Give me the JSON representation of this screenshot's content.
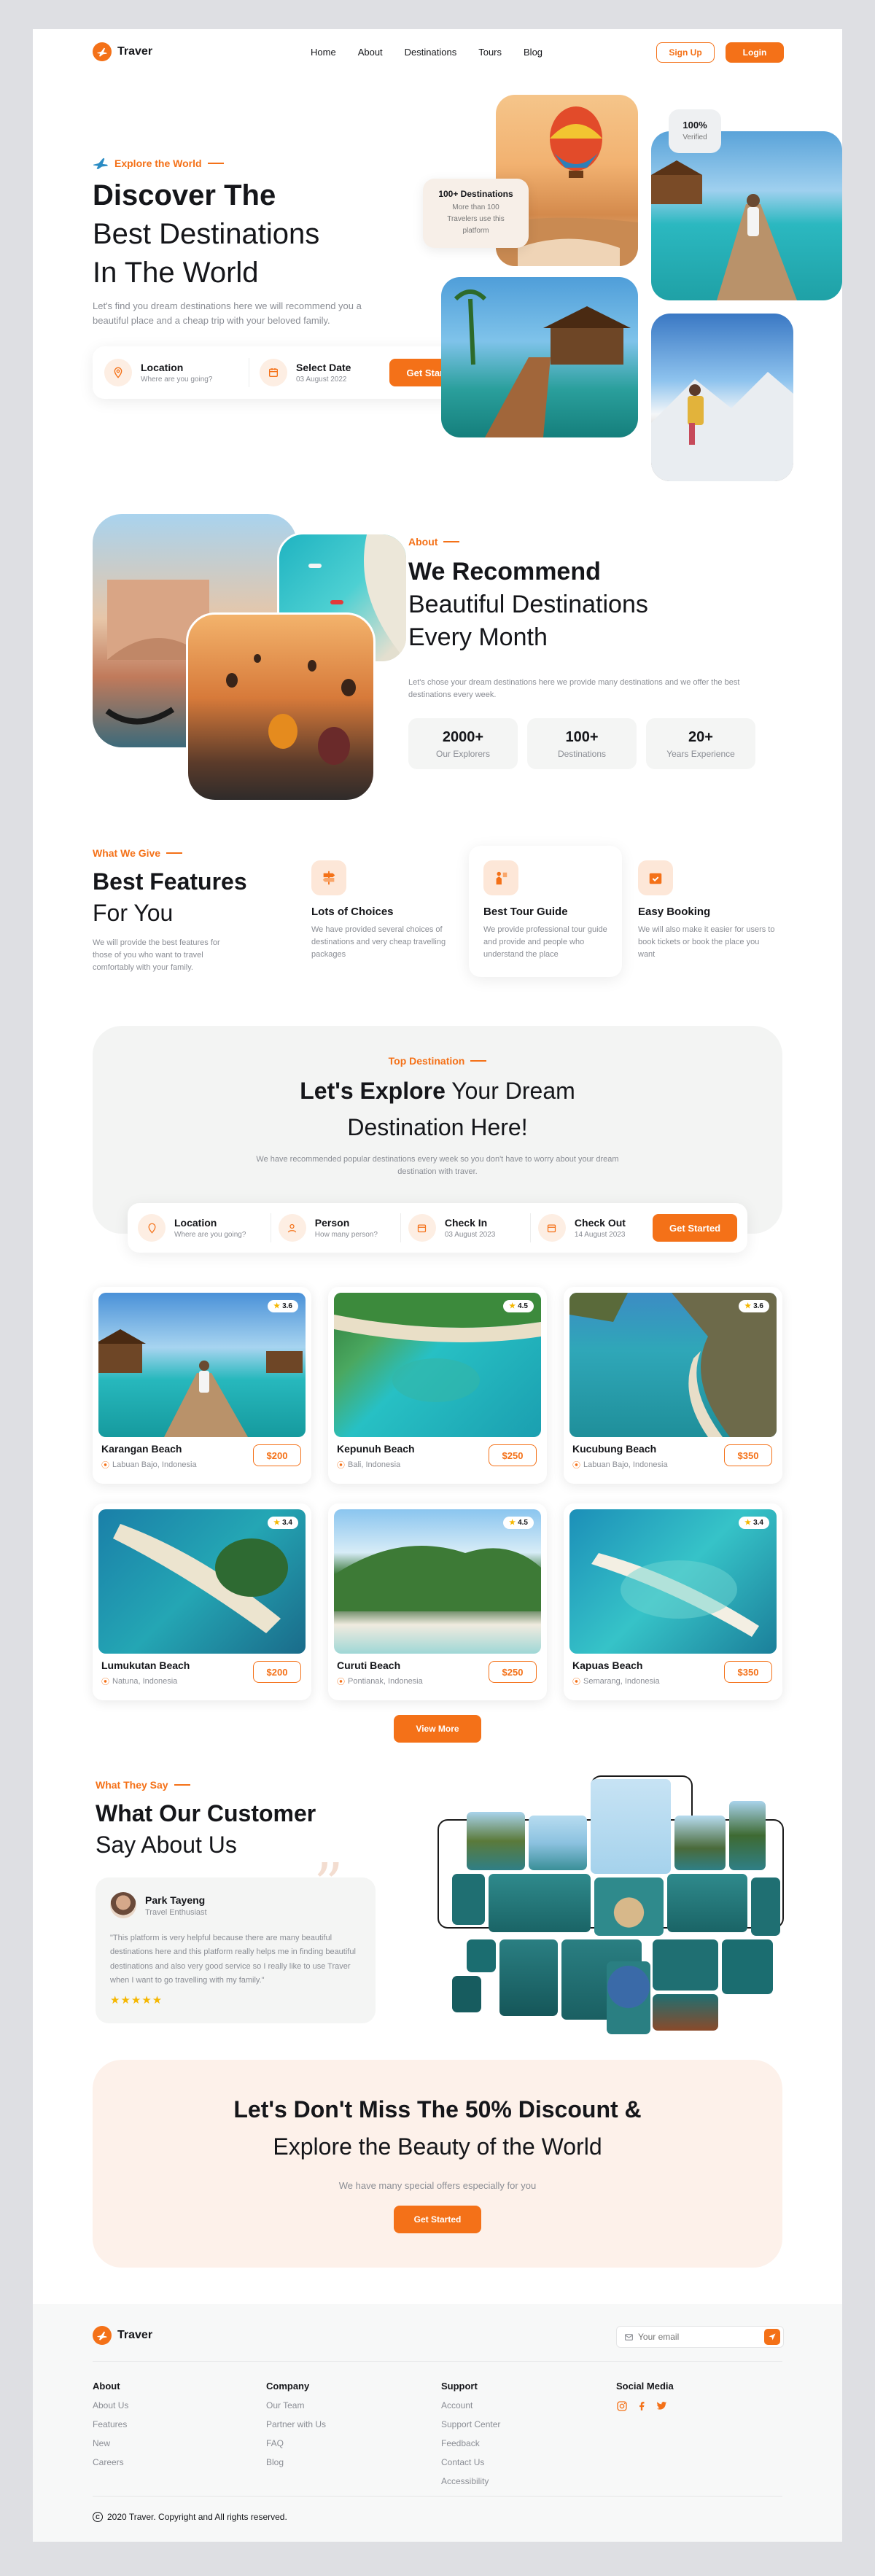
{
  "brand": {
    "name": "Traver",
    "accent": "#f47118"
  },
  "nav": {
    "items": [
      "Home",
      "About",
      "Destinations",
      "Tours",
      "Blog"
    ],
    "signup": "Sign Up",
    "login": "Login"
  },
  "hero": {
    "eyebrow": "Explore the World",
    "title_bold": "Discover The",
    "title_line2": "Best Destinations",
    "title_line3": "In The World",
    "desc": "Let's find you dream destinations here we will recommend you a beautiful place and a cheap trip with your beloved family.",
    "location_label": "Location",
    "location_sub": "Where are you going?",
    "date_label": "Select Date",
    "date_sub": "03 August 2022",
    "cta": "Get Started",
    "badge_title": "100+ Destinations",
    "badge_text": "More than 100 Travelers use this platform",
    "verified_num": "100%",
    "verified_label": "Verified"
  },
  "about": {
    "eyebrow": "About",
    "title_bold": "We Recommend",
    "title_line2": "Beautiful Destinations",
    "title_line3": "Every Month",
    "desc": "Let's chose your dream destinations here we provide many destinations and we offer the best destinations every week.",
    "stats": [
      {
        "n": "2000+",
        "l": "Our Explorers"
      },
      {
        "n": "100+",
        "l": "Destinations"
      },
      {
        "n": "20+",
        "l": "Years Experience"
      }
    ]
  },
  "features": {
    "eyebrow": "What We Give",
    "title_bold": "Best Features",
    "title_line2": "For You",
    "desc": "We will provide the best features for those of you who want to travel comfortably with your family.",
    "items": [
      {
        "t": "Lots of Choices",
        "d": "We have provided several choices of destinations and very cheap travelling packages",
        "icon": "signpost-icon"
      },
      {
        "t": "Best Tour Guide",
        "d": "We provide professional tour guide and provide and people who understand the place",
        "icon": "guide-icon"
      },
      {
        "t": "Easy Booking",
        "d": "We will also make it easier for users to book tickets or book the place you want",
        "icon": "calendar-check-icon"
      }
    ]
  },
  "explore": {
    "eyebrow": "Top Destination",
    "title_bold": "Let's Explore",
    "title_rest": "Your Dream",
    "title_line2": "Destination Here!",
    "desc": "We have recommended popular destinations every week so you don't have to worry about your dream destination with traver.",
    "search": [
      {
        "t": "Location",
        "s": "Where are you going?"
      },
      {
        "t": "Person",
        "s": "How many person?"
      },
      {
        "t": "Check In",
        "s": "03 August 2023"
      },
      {
        "t": "Check Out",
        "s": "14 August 2023"
      }
    ],
    "cta": "Get Started",
    "destinations": [
      {
        "name": "Karangan Beach",
        "loc": "Labuan Bajo, Indonesia",
        "price": "$200",
        "rating": "3.6"
      },
      {
        "name": "Kepunuh Beach",
        "loc": "Bali, Indonesia",
        "price": "$250",
        "rating": "4.5"
      },
      {
        "name": "Kucubung Beach",
        "loc": "Labuan Bajo, Indonesia",
        "price": "$350",
        "rating": "3.6"
      },
      {
        "name": "Lumukutan Beach",
        "loc": "Natuna, Indonesia",
        "price": "$200",
        "rating": "3.4"
      },
      {
        "name": "Curuti Beach",
        "loc": "Pontianak, Indonesia",
        "price": "$250",
        "rating": "4.5"
      },
      {
        "name": "Kapuas Beach",
        "loc": "Semarang, Indonesia",
        "price": "$350",
        "rating": "3.4"
      }
    ],
    "view_more": "View More"
  },
  "testimonial": {
    "eyebrow": "What They Say",
    "title_bold": "What Our Customer",
    "title_line2": "Say About Us",
    "name": "Park Tayeng",
    "role": "Travel Enthusiast",
    "quote": "\"This platform is very helpful because there are many beautiful destinations here and this platform really helps me in finding beautiful destinations and also very good service so I really like to use Traver when I want to go travelling with my family.\"",
    "stars": 5
  },
  "promo": {
    "title_line1": "Let's Don't Miss The 50% Discount &",
    "title_line2": "Explore the Beauty of the World",
    "desc": "We have many special offers especially for you",
    "cta": "Get Started"
  },
  "footer": {
    "email_placeholder": "Your email",
    "cols": [
      {
        "h": "About",
        "items": [
          "About Us",
          "Features",
          "New",
          "Careers"
        ]
      },
      {
        "h": "Company",
        "items": [
          "Our Team",
          "Partner with Us",
          "FAQ",
          "Blog"
        ]
      },
      {
        "h": "Support",
        "items": [
          "Account",
          "Support Center",
          "Feedback",
          "Contact Us",
          "Accessibility"
        ]
      }
    ],
    "social_h": "Social Media",
    "copyright": "2020 Traver. Copyright and All rights reserved."
  }
}
